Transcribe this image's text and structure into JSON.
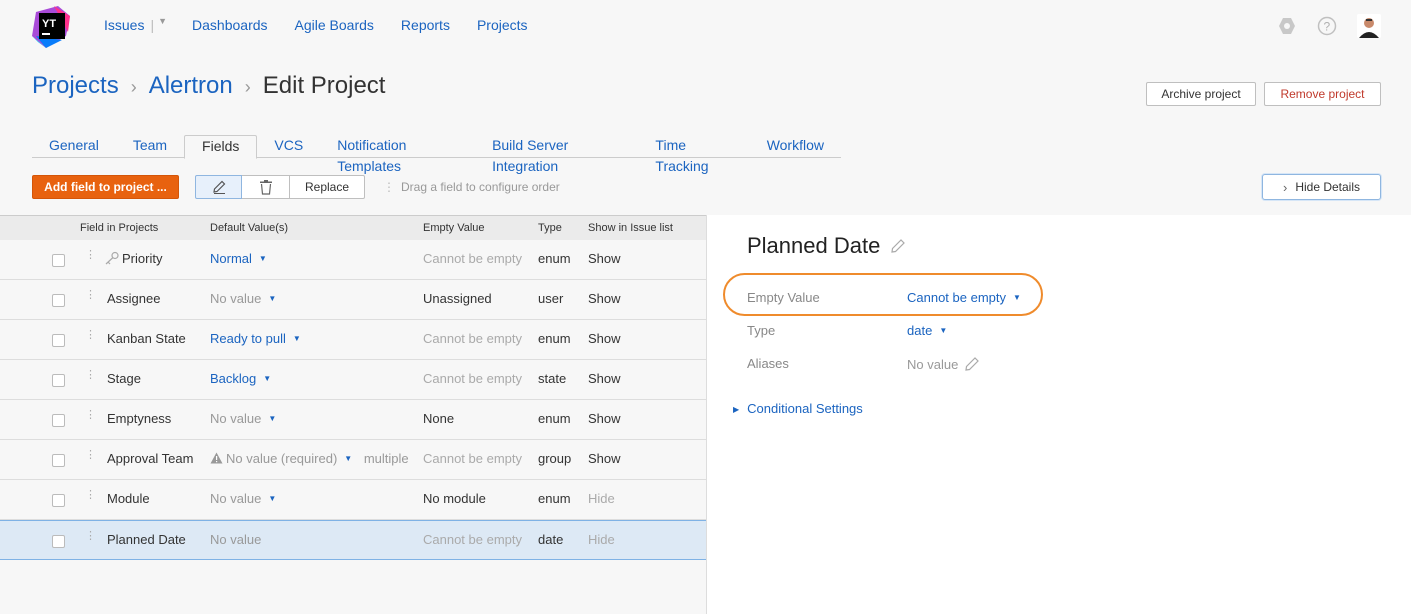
{
  "header": {
    "logo_text": "YT",
    "nav": [
      {
        "label": "Issues"
      },
      {
        "label": "Dashboards"
      },
      {
        "label": "Agile Boards"
      },
      {
        "label": "Reports"
      },
      {
        "label": "Projects"
      }
    ]
  },
  "breadcrumb": {
    "root": "Projects",
    "project": "Alertron",
    "current": "Edit Project"
  },
  "actions": {
    "archive": "Archive project",
    "remove": "Remove project"
  },
  "tabs": [
    {
      "label": "General"
    },
    {
      "label": "Team"
    },
    {
      "label": "Fields",
      "active": true
    },
    {
      "label": "VCS"
    },
    {
      "label": "Notification Templates"
    },
    {
      "label": "Build Server Integration"
    },
    {
      "label": "Time Tracking"
    },
    {
      "label": "Workflow"
    }
  ],
  "toolbar": {
    "add_field": "Add field to project ...",
    "replace": "Replace",
    "drag_hint": "Drag a field to configure order",
    "hide_details": "Hide Details"
  },
  "table": {
    "columns": [
      "Field in Projects",
      "Default Value(s)",
      "Empty Value",
      "Type",
      "Show in Issue list"
    ],
    "rows": [
      {
        "field": "Priority",
        "default": "Normal",
        "empty": "Cannot be empty",
        "type": "enum",
        "show": "Show"
      },
      {
        "field": "Assignee",
        "default": "No value",
        "empty": "Unassigned",
        "type": "user",
        "show": "Show"
      },
      {
        "field": "Kanban State",
        "default": "Ready to pull",
        "empty": "Cannot be empty",
        "type": "enum",
        "show": "Show"
      },
      {
        "field": "Stage",
        "default": "Backlog",
        "empty": "Cannot be empty",
        "type": "state",
        "show": "Show"
      },
      {
        "field": "Emptyness",
        "default": "No value",
        "empty": "None",
        "type": "enum",
        "show": "Show"
      },
      {
        "field": "Approval Team",
        "default": "No value (required)",
        "default_extra": "multiple",
        "empty": "Cannot be empty",
        "type": "group",
        "show": "Show"
      },
      {
        "field": "Module",
        "default": "No value",
        "empty": "No module",
        "type": "enum",
        "show": "Hide"
      },
      {
        "field": "Planned Date",
        "default": "No value",
        "empty": "Cannot be empty",
        "type": "date",
        "show": "Hide"
      }
    ]
  },
  "details": {
    "title": "Planned Date",
    "empty_value_label": "Empty Value",
    "empty_value": "Cannot be empty",
    "type_label": "Type",
    "type_value": "date",
    "aliases_label": "Aliases",
    "aliases_value": "No value",
    "conditional": "Conditional Settings"
  },
  "colors": {
    "accent": "#1b64c0",
    "primary_button": "#e8620f",
    "highlight_ring": "#ef8b2c"
  }
}
